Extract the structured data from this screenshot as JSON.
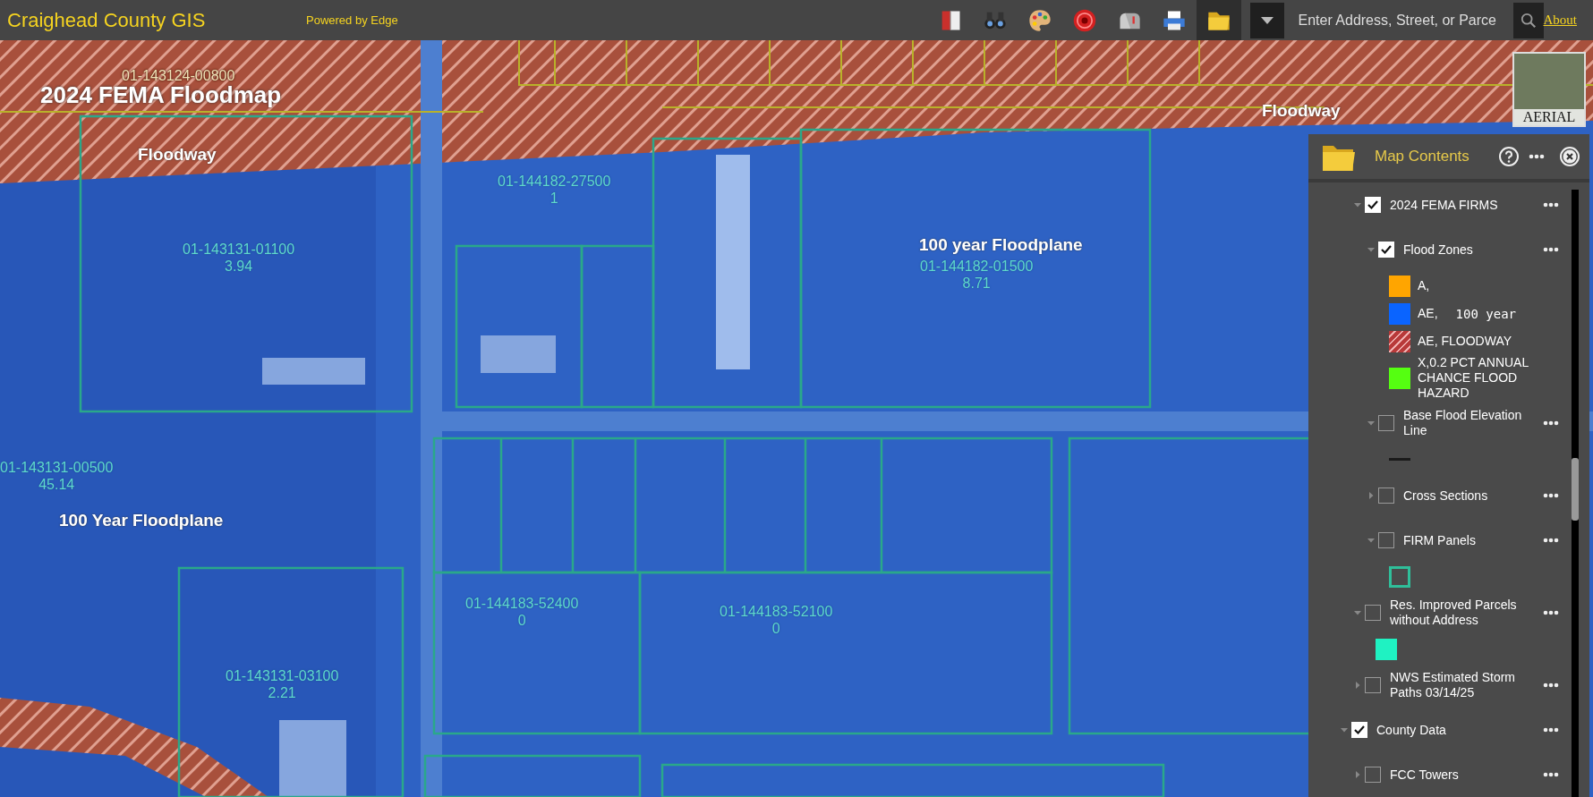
{
  "topbar": {
    "title": "Craighead County GIS",
    "subtitle": "Powered by Edge",
    "tools": [
      {
        "kind": "book",
        "selected": false
      },
      {
        "kind": "binoculars",
        "selected": false
      },
      {
        "kind": "palette",
        "selected": false
      },
      {
        "kind": "record",
        "selected": false
      },
      {
        "kind": "mailbox",
        "selected": false
      },
      {
        "kind": "printer",
        "selected": false
      },
      {
        "kind": "folder",
        "selected": true
      }
    ],
    "search": {
      "placeholder": "Enter Address, Street, or Parce"
    },
    "about": "About"
  },
  "map": {
    "labels": [
      {
        "kind": "parcel",
        "id": "01-143124-00800",
        "faint": true
      },
      {
        "kind": "title",
        "text": "2024 FEMA Floodmap"
      },
      {
        "kind": "zone",
        "text": "Floodway"
      },
      {
        "kind": "zone",
        "text": "Floodway"
      },
      {
        "kind": "parcel",
        "id": "01-144182-27500",
        "acres": "1"
      },
      {
        "kind": "parcel",
        "id": "01-143131-01100",
        "acres": "3.94"
      },
      {
        "kind": "zone",
        "text": "100 year Floodplane"
      },
      {
        "kind": "parcel",
        "id": "01-144182-01500",
        "acres": "8.71"
      },
      {
        "kind": "parcel",
        "id": "01-143131-00500",
        "acres": "45.14"
      },
      {
        "kind": "zone",
        "text": "100 Year Floodplane"
      },
      {
        "kind": "parcel",
        "id": "01-144183-52400",
        "acres": "0"
      },
      {
        "kind": "parcel",
        "id": "01-144183-52100",
        "acres": "0"
      },
      {
        "kind": "parcel",
        "id": "01-143131-03100",
        "acres": "2.21"
      }
    ],
    "basemap_button": {
      "label": "AERIAL"
    }
  },
  "panel": {
    "title": "Map Contents",
    "layers": [
      {
        "label": "2024 FEMA FIRMS",
        "checked": true,
        "expanded": true,
        "children": [
          {
            "label": "Flood Zones",
            "checked": true,
            "expanded": true,
            "legend": [
              {
                "kind": "fill",
                "color": "#ffa500",
                "label": "A,"
              },
              {
                "kind": "fill",
                "color": "#0a64ff",
                "label": "AE,",
                "note": "100 year"
              },
              {
                "kind": "hatch",
                "color": "#b83a3a",
                "label": "AE, FLOODWAY"
              },
              {
                "kind": "fill",
                "color": "#55ff11",
                "label": "X,0.2 PCT ANNUAL CHANCE FLOOD HAZARD"
              }
            ]
          },
          {
            "label": "Base Flood Elevation Line",
            "checked": false,
            "expanded": true,
            "legend": [
              {
                "kind": "line",
                "color": "#1a1a1a"
              }
            ]
          },
          {
            "label": "Cross Sections",
            "checked": false,
            "expanded": false
          },
          {
            "label": "FIRM Panels",
            "checked": false,
            "expanded": true,
            "legend": [
              {
                "kind": "outline",
                "color": "#2fbf9a"
              }
            ]
          }
        ]
      },
      {
        "label": "Res. Improved Parcels without Address",
        "checked": false,
        "expanded": true,
        "legend": [
          {
            "kind": "fill",
            "color": "#1ff2c2"
          }
        ]
      },
      {
        "label": "NWS Estimated Storm Paths 03/14/25",
        "checked": false,
        "expanded": false
      },
      {
        "label": "County Data",
        "checked": true,
        "expanded": true,
        "top": true,
        "children": [
          {
            "label": "FCC Towers",
            "checked": false,
            "expanded": false
          }
        ]
      }
    ]
  }
}
